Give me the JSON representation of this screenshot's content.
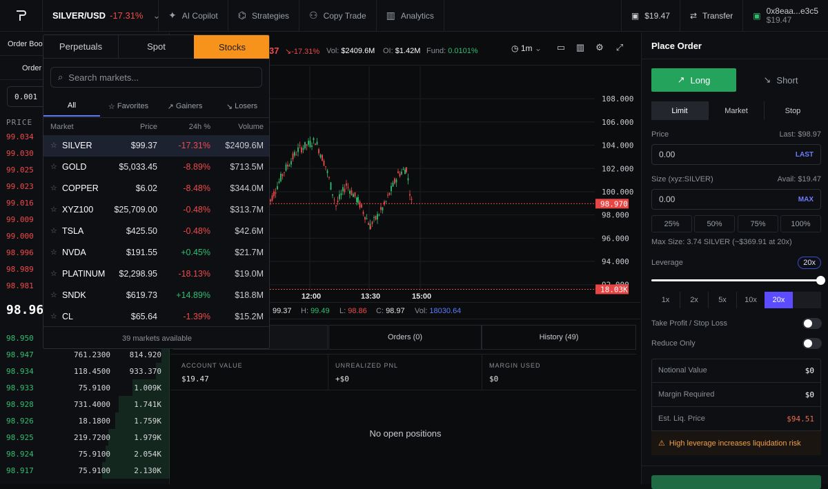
{
  "topbar": {
    "pair": "SILVER/USD",
    "pair_change": "-17.31%",
    "nav": [
      {
        "label": "AI Copilot",
        "icon": "sparkle-icon"
      },
      {
        "label": "Strategies",
        "icon": "strategy-icon"
      },
      {
        "label": "Copy Trade",
        "icon": "users-icon"
      },
      {
        "label": "Analytics",
        "icon": "bar-chart-icon"
      }
    ],
    "balance": "$19.47",
    "transfer": "Transfer",
    "wallet_address": "0x8eaa...e3c5",
    "wallet_balance": "$19.47"
  },
  "left": {
    "tab_order_book": "Order Boo",
    "tab_order": "Order",
    "size_value": "0.001",
    "price_header": "PRICE",
    "asks": [
      "99.034",
      "99.030",
      "99.025",
      "99.023",
      "99.016",
      "99.009",
      "99.000",
      "98.996",
      "98.989",
      "98.981"
    ],
    "mid_price": "98.960",
    "bids": [
      {
        "price": "98.950",
        "size": "",
        "total": "",
        "depth": 0
      },
      {
        "price": "98.947",
        "size": "761.2300",
        "total": "814.920",
        "depth": 0.05
      },
      {
        "price": "98.934",
        "size": "118.4500",
        "total": "933.370",
        "depth": 0.08
      },
      {
        "price": "98.933",
        "size": "75.9100",
        "total": "1.009K",
        "depth": 0.22
      },
      {
        "price": "98.928",
        "size": "731.4000",
        "total": "1.741K",
        "depth": 0.3
      },
      {
        "price": "98.926",
        "size": "18.1800",
        "total": "1.759K",
        "depth": 0.32
      },
      {
        "price": "98.925",
        "size": "219.7200",
        "total": "1.979K",
        "depth": 0.36
      },
      {
        "price": "98.924",
        "size": "75.9100",
        "total": "2.054K",
        "depth": 0.38
      },
      {
        "price": "98.917",
        "size": "75.9100",
        "total": "2.130K",
        "depth": 0.4
      }
    ]
  },
  "chart": {
    "price_partial": "37",
    "change": "-17.31%",
    "vol_label": "Vol:",
    "vol": "$2409.6M",
    "oi_label": "OI:",
    "oi": "$1.42M",
    "fund_label": "Fund:",
    "fund": "0.0101%",
    "timeframe": "1m",
    "y_ticks": [
      "108.000",
      "106.000",
      "104.000",
      "102.000",
      "100.000",
      "98.000",
      "96.000",
      "94.000",
      "92.000"
    ],
    "current_price_tag": "98.970",
    "volume_tag": "18.03K",
    "x_ticks": [
      "12:00",
      "13:30",
      "15:00"
    ],
    "ohlc": {
      "o": "99.37",
      "h_label": "H:",
      "h": "99.49",
      "l_label": "L:",
      "l": "98.86",
      "c_label": "C:",
      "c": "98.97",
      "v_label": "Vol:",
      "v": "18030.64"
    },
    "last_price": 98.97
  },
  "bottom": {
    "tab_positions_partial": ")",
    "tab_orders": "Orders (0)",
    "tab_history": "History (49)",
    "account_value_label": "ACCOUNT VALUE",
    "account_value": "$19.47",
    "unrealized_label": "UNREALIZED PNL",
    "unrealized": "+$0",
    "margin_used_label": "MARGIN USED",
    "margin_used": "$0",
    "no_positions": "No open positions"
  },
  "order": {
    "title": "Place Order",
    "long": "Long",
    "short": "Short",
    "types": [
      "Limit",
      "Market",
      "Stop"
    ],
    "price_label": "Price",
    "last_label": "Last: $98.97",
    "price_placeholder": "0.00",
    "last_btn": "LAST",
    "size_label": "Size (xyz:SILVER)",
    "avail_label": "Avail: $19.47",
    "size_placeholder": "0.00",
    "max_btn": "MAX",
    "pcts": [
      "25%",
      "50%",
      "75%",
      "100%"
    ],
    "max_size": "Max Size: 3.74 SILVER (~$369.91 at 20x)",
    "leverage_label": "Leverage",
    "leverage_value": "20x",
    "leverage_fraction": 1.0,
    "lev_options": [
      "1x",
      "2x",
      "5x",
      "10x",
      "20x"
    ],
    "tpsl": "Take Profit / Stop Loss",
    "reduce_only": "Reduce Only",
    "summary": [
      {
        "label": "Notional Value",
        "value": "$0"
      },
      {
        "label": "Margin Required",
        "value": "$0"
      },
      {
        "label": "Est. Liq. Price",
        "value": "$94.51"
      }
    ],
    "warning": "High leverage increases liquidation risk"
  },
  "dropdown": {
    "tabs": [
      "Perpetuals",
      "Spot",
      "Stocks"
    ],
    "search_placeholder": "Search markets...",
    "filters": [
      "All",
      "Favorites",
      "Gainers",
      "Losers"
    ],
    "headers": {
      "market": "Market",
      "price": "Price",
      "change": "24h %",
      "volume": "Volume"
    },
    "rows": [
      {
        "name": "SILVER",
        "price": "$99.37",
        "change": "-17.31%",
        "volume": "$2409.6M"
      },
      {
        "name": "GOLD",
        "price": "$5,033.45",
        "change": "-8.89%",
        "volume": "$713.5M"
      },
      {
        "name": "COPPER",
        "price": "$6.02",
        "change": "-8.48%",
        "volume": "$344.0M"
      },
      {
        "name": "XYZ100",
        "price": "$25,709.00",
        "change": "-0.48%",
        "volume": "$313.7M"
      },
      {
        "name": "TSLA",
        "price": "$425.50",
        "change": "-0.48%",
        "volume": "$42.6M"
      },
      {
        "name": "NVDA",
        "price": "$191.55",
        "change": "+0.45%",
        "volume": "$21.7M"
      },
      {
        "name": "PLATINUM",
        "price": "$2,298.95",
        "change": "-18.13%",
        "volume": "$19.0M"
      },
      {
        "name": "SNDK",
        "price": "$619.73",
        "change": "+14.89%",
        "volume": "$18.8M"
      },
      {
        "name": "CL",
        "price": "$65.64",
        "change": "-1.39%",
        "volume": "$15.2M"
      }
    ],
    "footer": "39 markets available"
  },
  "colors": {
    "accent": "#f7931a",
    "long": "#2fbf71",
    "short": "#ef4b4b",
    "selected_lev": "#5b4cff"
  }
}
